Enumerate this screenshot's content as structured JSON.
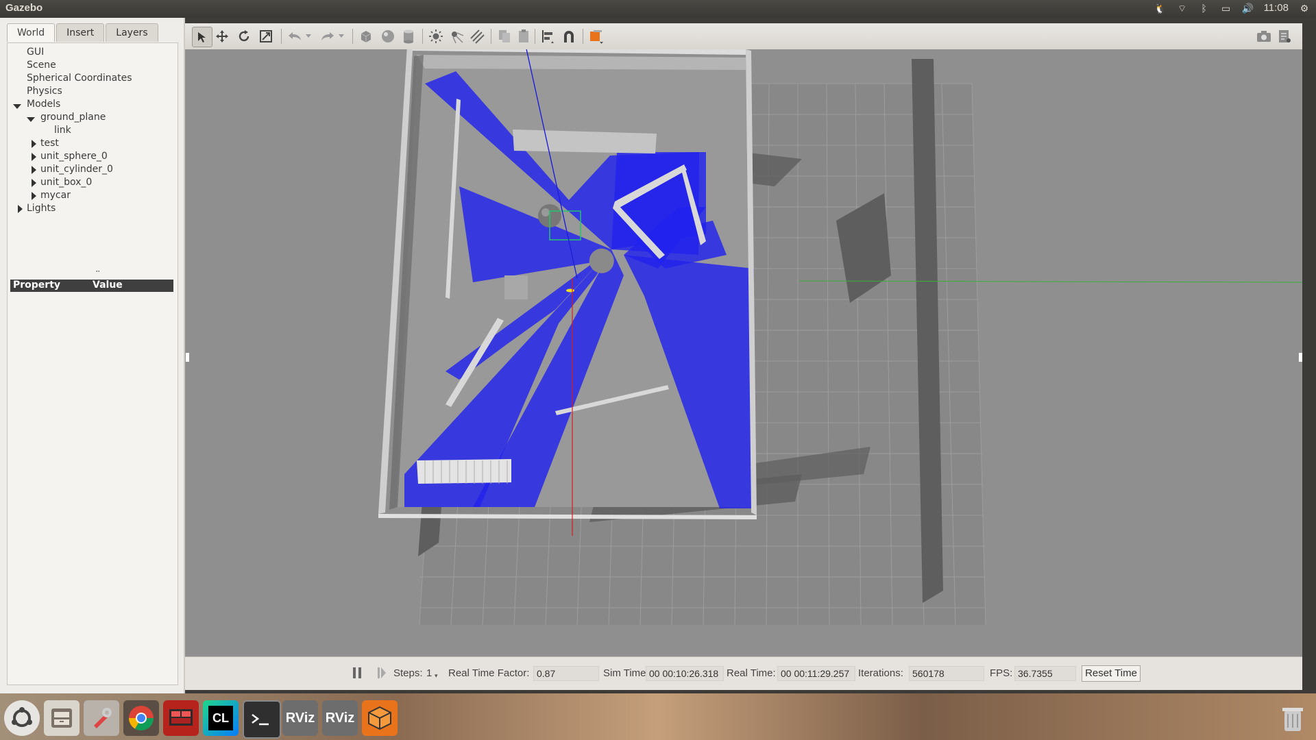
{
  "window": {
    "title": "Gazebo"
  },
  "tray": {
    "clock": "11:08"
  },
  "left_panel": {
    "tabs": [
      {
        "label": "World",
        "active": true
      },
      {
        "label": "Insert",
        "active": false
      },
      {
        "label": "Layers",
        "active": false
      }
    ],
    "tree": {
      "gui": "GUI",
      "scene": "Scene",
      "spherical": "Spherical Coordinates",
      "physics": "Physics",
      "models": "Models",
      "ground_plane": "ground_plane",
      "link": "link",
      "test": "test",
      "unit_sphere": "unit_sphere_0",
      "unit_cylinder": "unit_cylinder_0",
      "unit_box": "unit_box_0",
      "mycar": "mycar",
      "lights": "Lights"
    },
    "property_table": {
      "col_property": "Property",
      "col_value": "Value"
    }
  },
  "status": {
    "steps_label": "Steps:",
    "steps_value": "1",
    "rtf_label": "Real Time Factor:",
    "rtf_value": "0.87",
    "sim_time_label": "Sim Time:",
    "sim_time_value": "00 00:10:26.318",
    "real_time_label": "Real Time:",
    "real_time_value": "00 00:11:29.257",
    "iterations_label": "Iterations:",
    "iterations_value": "560178",
    "fps_label": "FPS:",
    "fps_value": "36.7355",
    "reset_label": "Reset Time"
  },
  "dock": {
    "clion_label": "CL",
    "rviz_label": "RViz"
  },
  "colors": {
    "laser": "#2222ee",
    "floor": "#8f8f8f",
    "wall": "#d8d8d8",
    "accent_orange": "#e8731a"
  }
}
